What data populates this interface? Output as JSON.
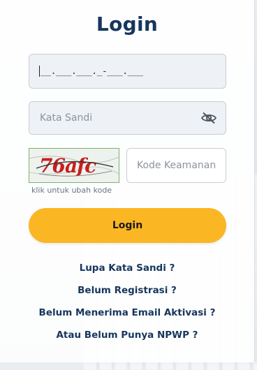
{
  "login_form": {
    "title": "Login",
    "npwp_field": {
      "value": "__.___.___._-___.___"
    },
    "password_field": {
      "placeholder": "Kata Sandi",
      "toggle_icon": "eye-slash-icon"
    },
    "captcha": {
      "image_text": "76afc",
      "caption": "klik untuk ubah kode"
    },
    "security_code_field": {
      "placeholder": "Kode Keamanan"
    },
    "login_button_label": "Login",
    "links": {
      "forgot_password": "Lupa Kata Sandi ?",
      "register": "Belum Registrasi ?",
      "activation_email": "Belum Menerima Email Aktivasi ?",
      "no_npwp": "Atau Belum Punya NPWP ?"
    }
  },
  "colors": {
    "title": "#17365d",
    "button": "#fbb623",
    "captcha_text": "#c81e1e"
  }
}
